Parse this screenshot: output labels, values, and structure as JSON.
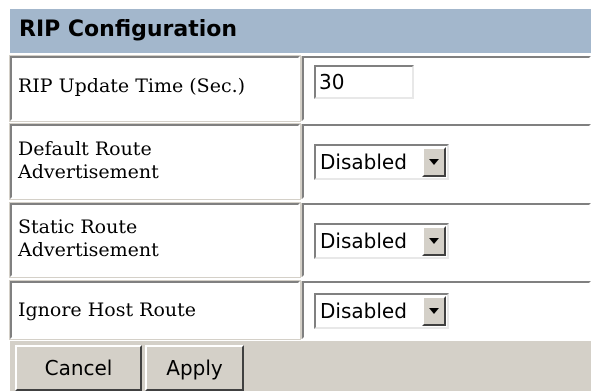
{
  "panel": {
    "title": "RIP Configuration"
  },
  "rows": [
    {
      "label": "RIP Update Time (Sec.)",
      "control": "text-input",
      "value": "30"
    },
    {
      "label_line1": "Default Route",
      "label_line2": "Advertisement",
      "control": "select",
      "value": "Disabled"
    },
    {
      "label_line1": "Static Route",
      "label_line2": "Advertisement",
      "control": "select",
      "value": "Disabled"
    },
    {
      "label": "Ignore Host Route",
      "control": "select",
      "value": "Disabled"
    }
  ],
  "actions": {
    "cancel_label": "Cancel",
    "apply_label": "Apply"
  },
  "colors": {
    "header_background": "#a3b7cc",
    "panel_background": "#d4d0c8",
    "cell_background": "#ffffff"
  },
  "icons": {
    "dropdown": "chevron-down-icon"
  }
}
